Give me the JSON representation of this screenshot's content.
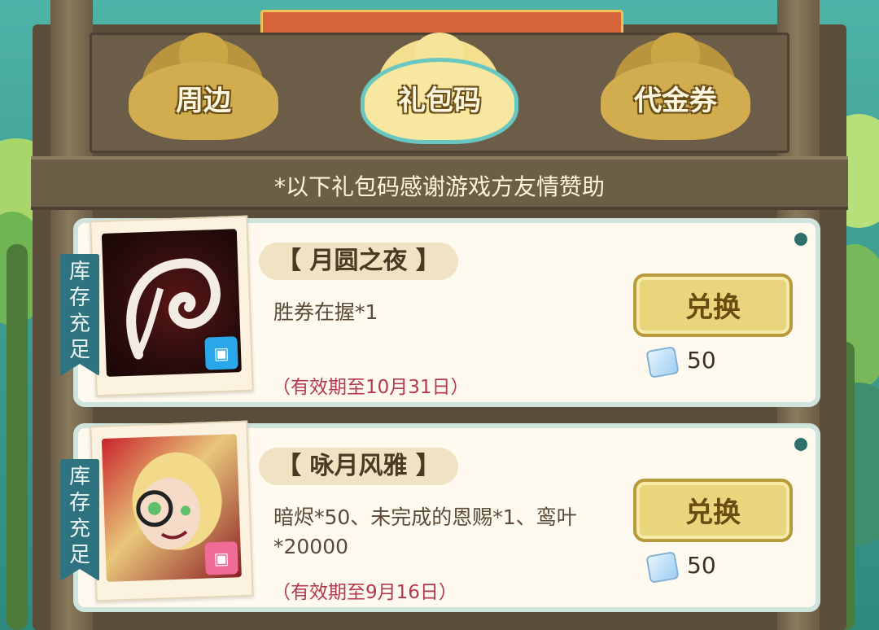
{
  "tabs": [
    {
      "label": "周边",
      "active": false
    },
    {
      "label": "礼包码",
      "active": true
    },
    {
      "label": "代金券",
      "active": false
    }
  ],
  "notice": "*以下礼包码感谢游戏方友情赞助",
  "items": [
    {
      "ribbon": "库存充足",
      "title": "【 月圆之夜 】",
      "description": "胜券在握*1",
      "expiry": "（有效期至10月31日）",
      "button_label": "兑换",
      "price": "50",
      "badge_color": "#2aa7e8"
    },
    {
      "ribbon": "库存充足",
      "title": "【 咏月风雅 】",
      "description": "暗烬*50、未完成的恩赐*1、鸾叶*20000",
      "expiry": "（有效期至9月16日）",
      "button_label": "兑换",
      "price": "50",
      "badge_color": "#f06b96"
    }
  ],
  "icons": {
    "currency": "diamond-gem-icon",
    "platform_badge": "bilibili-tv-icon"
  },
  "colors": {
    "accent_teal": "#68c7c0",
    "gold": "#d1ad4f",
    "expiry_red": "#b33a4a"
  }
}
